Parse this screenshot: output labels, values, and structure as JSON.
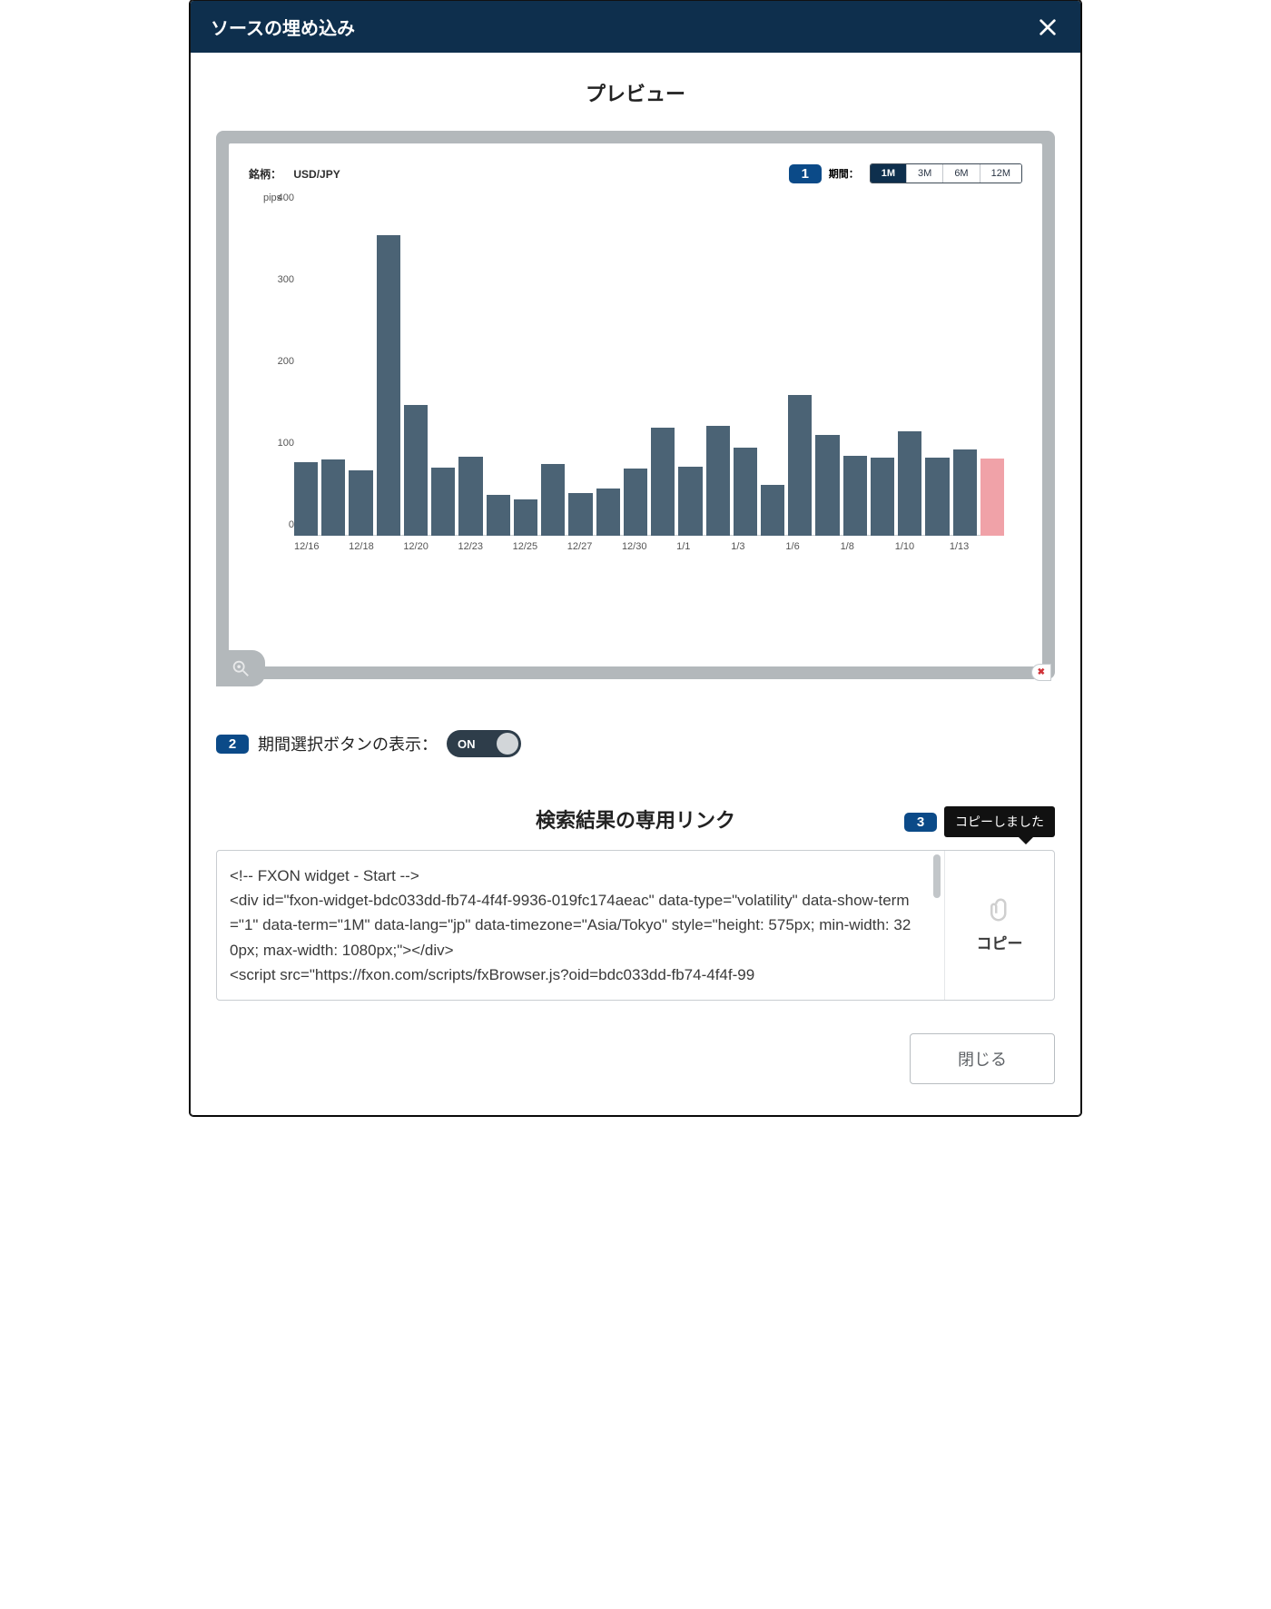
{
  "header": {
    "title": "ソースの埋め込み"
  },
  "preview": {
    "title": "プレビュー",
    "chart": {
      "symbol_label": "銘柄：",
      "symbol_value": "USD/JPY",
      "term_label": "期間：",
      "badge": "1",
      "term_options": [
        "1M",
        "3M",
        "6M",
        "12M"
      ],
      "term_active": 0,
      "logo": "✖"
    }
  },
  "chart_data": {
    "type": "bar",
    "unit_label": "pips",
    "ylim": [
      0,
      400
    ],
    "yticks": [
      0,
      100,
      200,
      300,
      400
    ],
    "x_ticks": [
      "12/16",
      "12/18",
      "12/20",
      "12/23",
      "12/25",
      "12/27",
      "12/30",
      "1/1",
      "1/3",
      "1/6",
      "1/8",
      "1/10",
      "1/13"
    ],
    "bars": [
      {
        "v": 90
      },
      {
        "v": 93
      },
      {
        "v": 80
      },
      {
        "v": 368
      },
      {
        "v": 160
      },
      {
        "v": 83
      },
      {
        "v": 97
      },
      {
        "v": 50
      },
      {
        "v": 45
      },
      {
        "v": 88
      },
      {
        "v": 52
      },
      {
        "v": 58
      },
      {
        "v": 82
      },
      {
        "v": 132
      },
      {
        "v": 84
      },
      {
        "v": 135
      },
      {
        "v": 108
      },
      {
        "v": 62
      },
      {
        "v": 172
      },
      {
        "v": 123
      },
      {
        "v": 98
      },
      {
        "v": 96
      },
      {
        "v": 128
      },
      {
        "v": 96
      },
      {
        "v": 106
      },
      {
        "v": 95,
        "alt": true
      }
    ]
  },
  "controls": {
    "badge": "2",
    "label": "期間選択ボタンの表示：",
    "toggle_text": "ON"
  },
  "link": {
    "badge": "3",
    "title": "検索結果の専用リンク",
    "tooltip": "コピーしました",
    "copy_label": "コピー",
    "code": "<!-- FXON widget - Start -->\n<div id=\"fxon-widget-bdc033dd-fb74-4f4f-9936-019fc174aeac\" data-type=\"volatility\" data-show-term=\"1\" data-term=\"1M\" data-lang=\"jp\" data-timezone=\"Asia/Tokyo\" style=\"height: 575px; min-width: 320px; max-width: 1080px;\"></div>\n<script src=\"https://fxon.com/scripts/fxBrowser.js?oid=bdc033dd-fb74-4f4f-99"
  },
  "footer": {
    "close": "閉じる"
  }
}
